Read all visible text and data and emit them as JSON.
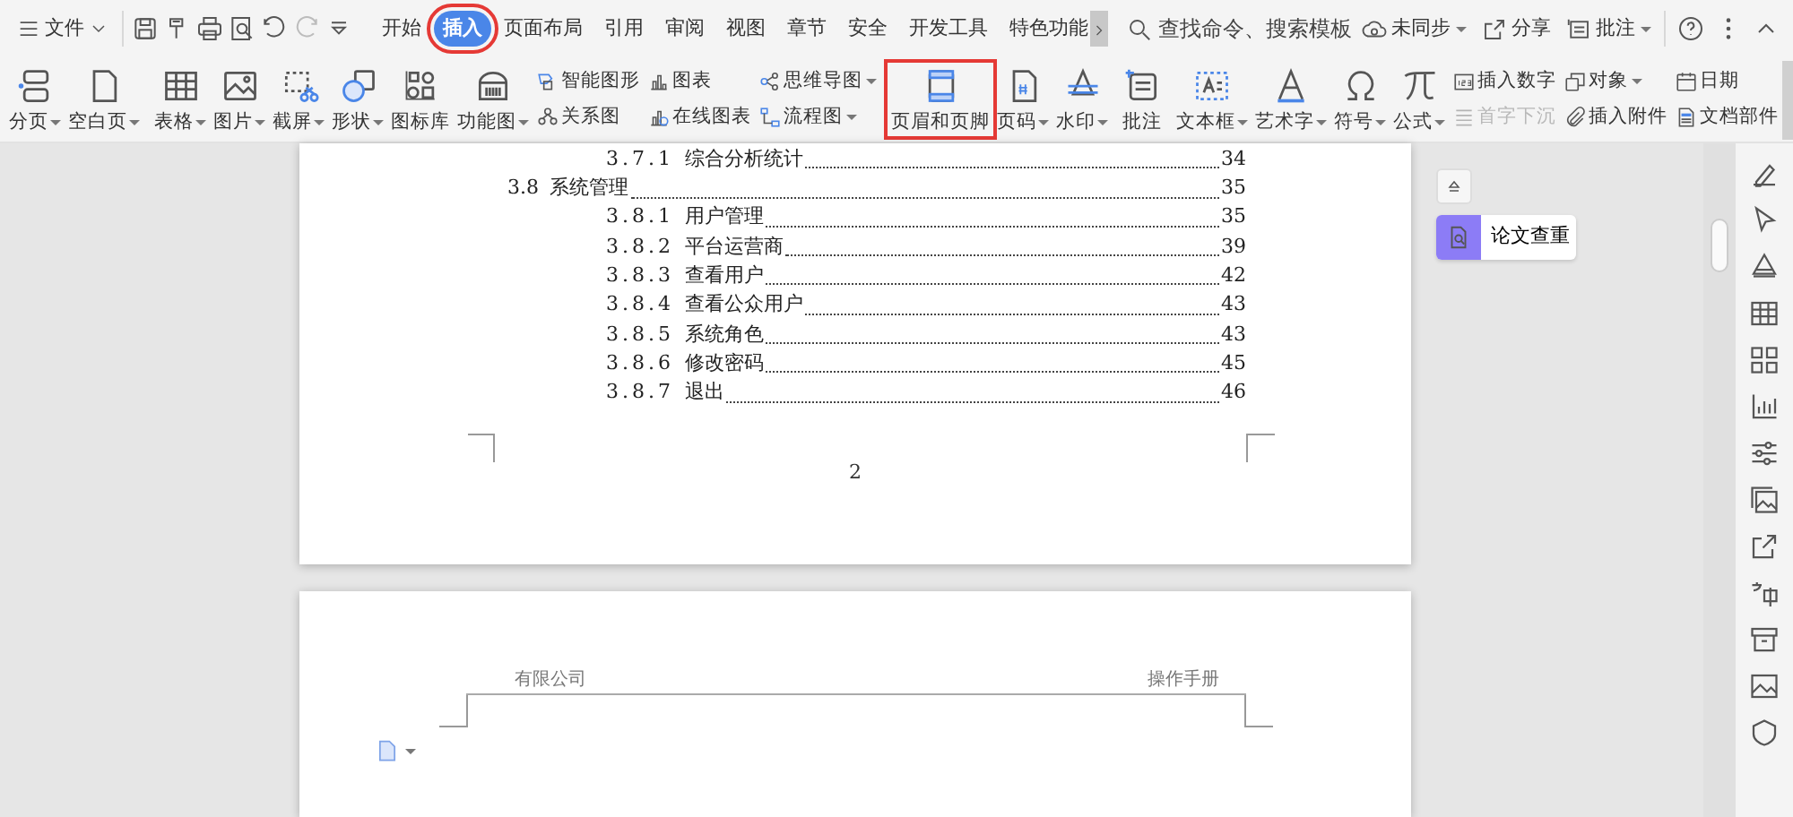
{
  "menu": {
    "label": "文件"
  },
  "quick_tools": [
    {
      "disabled": false
    },
    {
      "disabled": false
    },
    {
      "disabled": false
    },
    {
      "disabled": false
    },
    {
      "disabled": false
    },
    {
      "disabled": true
    },
    {
      "disabled": false
    }
  ],
  "tabs": [
    {
      "label": "开始",
      "selected": false,
      "highlighted": false
    },
    {
      "label": "插入",
      "selected": true,
      "highlighted": true
    },
    {
      "label": "页面布局",
      "selected": false,
      "highlighted": false
    },
    {
      "label": "引用",
      "selected": false,
      "highlighted": false
    },
    {
      "label": "审阅",
      "selected": false,
      "highlighted": false
    },
    {
      "label": "视图",
      "selected": false,
      "highlighted": false
    },
    {
      "label": "章节",
      "selected": false,
      "highlighted": false
    },
    {
      "label": "安全",
      "selected": false,
      "highlighted": false
    },
    {
      "label": "开发工具",
      "selected": false,
      "highlighted": false
    },
    {
      "label": "特色功能",
      "selected": false,
      "highlighted": false
    }
  ],
  "search": {
    "placeholder": "查找命令、搜索模板"
  },
  "top_actions": [
    {
      "label": "未同步",
      "dropdown": true
    },
    {
      "label": "分享",
      "dropdown": false
    },
    {
      "label": "批注",
      "dropdown": true
    }
  ],
  "ribbon": [
    {
      "kind": "large",
      "label": "分页",
      "dropdown": true,
      "highlighted": false
    },
    {
      "kind": "large",
      "label": "空白页",
      "dropdown": true,
      "highlighted": false
    },
    {
      "kind": "separator"
    },
    {
      "kind": "large",
      "label": "表格",
      "dropdown": true,
      "highlighted": false
    },
    {
      "kind": "large",
      "label": "图片",
      "dropdown": true,
      "highlighted": false
    },
    {
      "kind": "large",
      "label": "截屏",
      "dropdown": true,
      "highlighted": false
    },
    {
      "kind": "large",
      "label": "形状",
      "dropdown": true,
      "highlighted": false
    },
    {
      "kind": "large",
      "label": "图标库",
      "dropdown": false,
      "highlighted": false
    },
    {
      "kind": "large",
      "label": "功能图",
      "dropdown": true,
      "highlighted": false
    },
    {
      "kind": "stack",
      "items": [
        {
          "label": "智能图形",
          "dropdown": false,
          "disabled": false
        },
        {
          "label": "关系图",
          "dropdown": false,
          "disabled": false
        }
      ]
    },
    {
      "kind": "stack",
      "items": [
        {
          "label": "图表",
          "dropdown": false,
          "disabled": false
        },
        {
          "label": "在线图表",
          "dropdown": false,
          "disabled": false
        }
      ]
    },
    {
      "kind": "stack",
      "items": [
        {
          "label": "思维导图",
          "dropdown": true,
          "disabled": false
        },
        {
          "label": "流程图",
          "dropdown": true,
          "disabled": false
        }
      ]
    },
    {
      "kind": "separator"
    },
    {
      "kind": "large",
      "label": "页眉和页脚",
      "dropdown": false,
      "highlighted": true
    },
    {
      "kind": "large",
      "label": "页码",
      "dropdown": true,
      "highlighted": false
    },
    {
      "kind": "large",
      "label": "水印",
      "dropdown": true,
      "highlighted": false
    },
    {
      "kind": "separator"
    },
    {
      "kind": "large",
      "label": "批注",
      "dropdown": false,
      "highlighted": false
    },
    {
      "kind": "separator"
    },
    {
      "kind": "large",
      "label": "文本框",
      "dropdown": true,
      "highlighted": false
    },
    {
      "kind": "large",
      "label": "艺术字",
      "dropdown": true,
      "highlighted": false
    },
    {
      "kind": "large",
      "label": "符号",
      "dropdown": true,
      "highlighted": false
    },
    {
      "kind": "large",
      "label": "公式",
      "dropdown": true,
      "highlighted": false
    },
    {
      "kind": "stack",
      "items": [
        {
          "label": "插入数字",
          "dropdown": false,
          "disabled": false
        },
        {
          "label": "首字下沉",
          "dropdown": false,
          "disabled": true
        }
      ]
    },
    {
      "kind": "stack",
      "items": [
        {
          "label": "对象",
          "dropdown": true,
          "disabled": false
        },
        {
          "label": "插入附件",
          "dropdown": false,
          "disabled": false
        }
      ]
    },
    {
      "kind": "stack",
      "items": [
        {
          "label": "日期",
          "dropdown": false,
          "disabled": false
        },
        {
          "label": "文档部件",
          "dropdown": false,
          "disabled": false
        }
      ]
    }
  ],
  "document": {
    "toc": [
      {
        "kind": "sub",
        "number": "3.7.1",
        "title": "综合分析统计",
        "page": "34"
      },
      {
        "kind": "section",
        "number": "3.8",
        "title": "系统管理",
        "page": "35",
        "children": [
          {
            "kind": "sub",
            "number": "3.8.1",
            "title": "用户管理",
            "page": "35"
          },
          {
            "kind": "sub",
            "number": "3.8.2",
            "title": "平台运营商",
            "page": "39"
          },
          {
            "kind": "sub",
            "number": "3.8.3",
            "title": "查看用户",
            "page": "42"
          },
          {
            "kind": "sub",
            "number": "3.8.4",
            "title": "查看公众用户",
            "page": "43"
          },
          {
            "kind": "sub",
            "number": "3.8.5",
            "title": "系统角色",
            "page": "43"
          },
          {
            "kind": "sub",
            "number": "3.8.6",
            "title": "修改密码",
            "page": "45"
          },
          {
            "kind": "sub",
            "number": "3.8.7",
            "title": "退出",
            "page": "46"
          }
        ]
      }
    ],
    "page_number": "2",
    "header": {
      "left": "有限公司",
      "right": "操作手册"
    }
  },
  "side_panel": {
    "items": [
      {
        "label": "论文查重"
      }
    ]
  }
}
